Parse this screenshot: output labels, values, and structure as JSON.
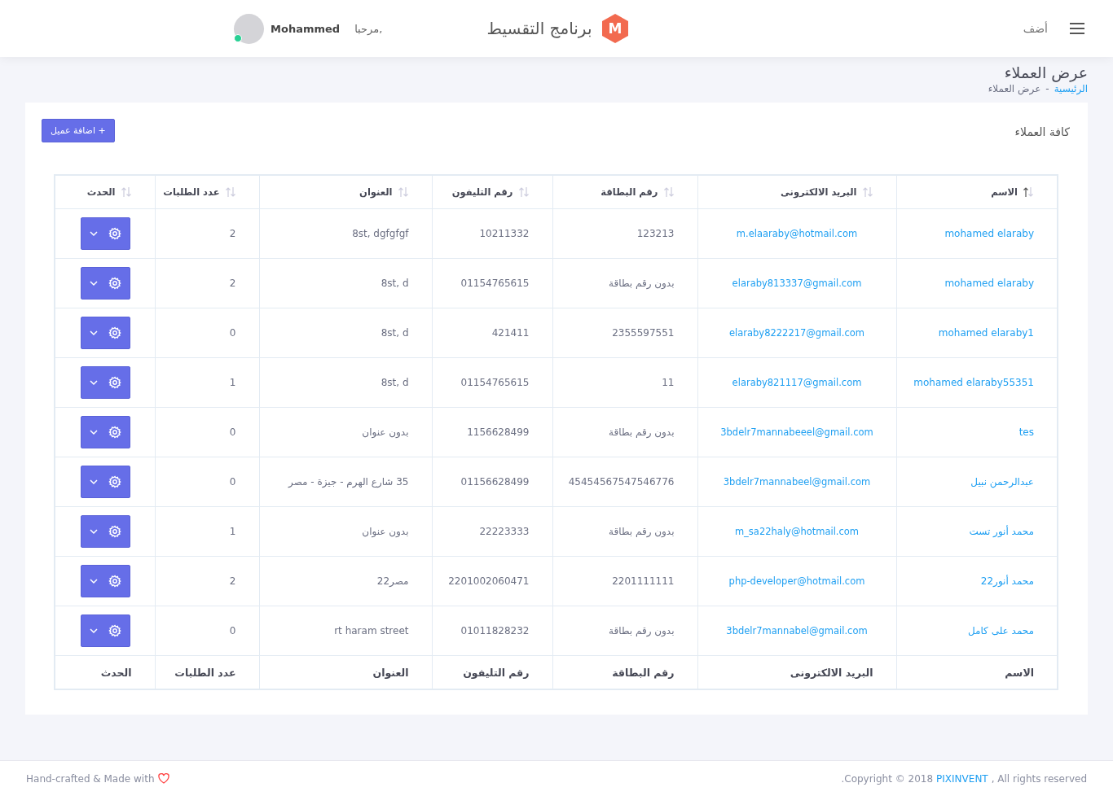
{
  "header": {
    "menu_label": "أضف",
    "app_title": "برنامج التقسيط",
    "logo_letter": "M",
    "greeting": "مرحبا,",
    "user_name": "Mohammed",
    "online": true
  },
  "page": {
    "title": "عرض العملاء",
    "separator": "-",
    "breadcrumbs": [
      {
        "label": "الرئيسية",
        "link": true
      },
      {
        "label": "عرض العملاء",
        "link": false
      }
    ]
  },
  "card": {
    "title": "كافة العملاء",
    "add_button": "اضافة عميل",
    "add_icon": "+"
  },
  "table": {
    "columns": [
      {
        "label": "الاسم",
        "sorted": true
      },
      {
        "label": "البريد الالكترونى",
        "sorted": false
      },
      {
        "label": "رقم البطاقة",
        "sorted": false
      },
      {
        "label": "رقم التليفون",
        "sorted": false
      },
      {
        "label": "العنوان",
        "sorted": false
      },
      {
        "label": "عدد الطلبات",
        "sorted": false
      },
      {
        "label": "الحدث",
        "sorted": false
      }
    ],
    "rows": [
      {
        "name": "mohamed elaraby",
        "email": "m.elaaraby@hotmail.com",
        "card": "123213",
        "phone": "10211332",
        "address": "8st, dgfgfgf",
        "orders": "2"
      },
      {
        "name": "mohamed elaraby",
        "email": "elaraby813337@gmail.com",
        "card": "بدون رقم بطاقة",
        "phone": "01154765615",
        "address": "8st, d",
        "orders": "2"
      },
      {
        "name": "mohamed elaraby1",
        "email": "elaraby8222217@gmail.com",
        "card": "2355597551",
        "phone": "421411",
        "address": "8st, d",
        "orders": "0"
      },
      {
        "name": "mohamed elaraby55351",
        "email": "elaraby821117@gmail.com",
        "card": "11",
        "phone": "01154765615",
        "address": "8st, d",
        "orders": "1"
      },
      {
        "name": "tes",
        "email": "3bdelr7mannabeeel@gmail.com",
        "card": "بدون رقم بطاقة",
        "phone": "1156628499",
        "address": "بدون عنوان",
        "orders": "0"
      },
      {
        "name": "عبدالرحمن نبيل",
        "email": "3bdelr7mannabeel@gmail.com",
        "card": "45454567547546776",
        "phone": "01156628499",
        "address": "35 شارع الهرم - جيزة - مصر",
        "orders": "0"
      },
      {
        "name": "محمد أنور تست",
        "email": "m_sa22haly@hotmail.com",
        "card": "بدون رقم بطاقة",
        "phone": "22223333",
        "address": "بدون عنوان",
        "orders": "1"
      },
      {
        "name": "محمد أنور22",
        "email": "php-developer@hotmail.com",
        "card": "2201111111",
        "phone": "2201002060471",
        "address": "مصر22",
        "orders": "2"
      },
      {
        "name": "محمد على كامل",
        "email": "3bdelr7mannabel@gmail.com",
        "card": "بدون رقم بطاقة",
        "phone": "01011828232",
        "address": "rt haram street",
        "orders": "0"
      }
    ],
    "footer_columns": [
      "الاسم",
      "البريد الالكترونى",
      "رقم البطاقة",
      "رقم التليفون",
      "العنوان",
      "عدد الطلبات",
      "الحدث"
    ]
  },
  "footer": {
    "made_with": "Hand-crafted & Made with",
    "copyright_prefix": ".Copyright © 2018",
    "company": "PIXINVENT",
    "copyright_suffix": ", All rights reserved"
  }
}
